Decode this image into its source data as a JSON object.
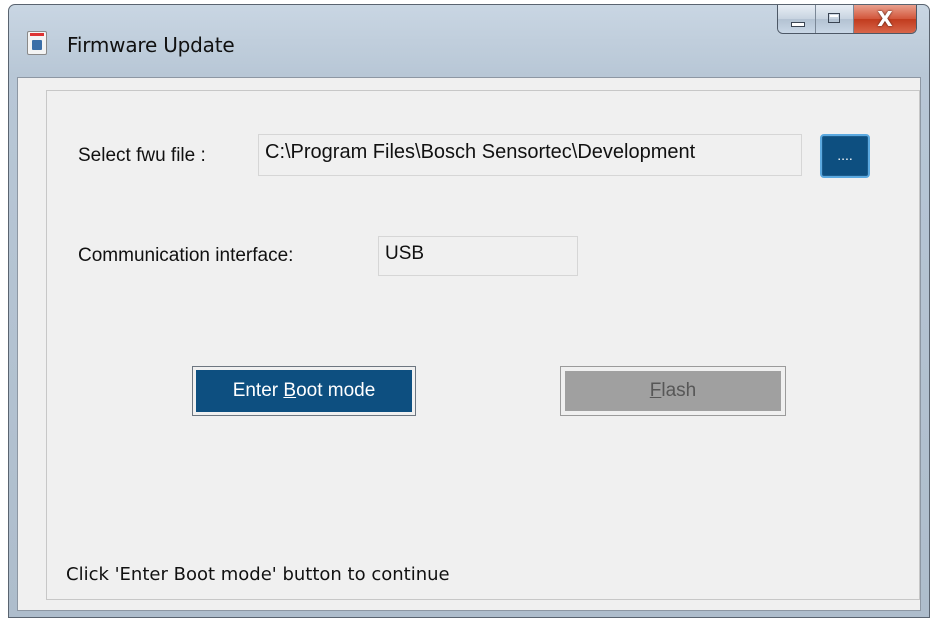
{
  "window": {
    "title": "Firmware Update",
    "icon": "bosch-app-icon"
  },
  "caption_buttons": {
    "minimize_icon": "minimize-icon",
    "maximize_icon": "maximize-icon",
    "close_glyph": "X"
  },
  "form": {
    "file_label": "Select fwu file :",
    "file_value": "C:\\Program Files\\Bosch Sensortec\\Development",
    "browse_label": "....",
    "interface_label": "Communication interface:",
    "interface_value": "USB"
  },
  "buttons": {
    "boot_prefix": "Enter ",
    "boot_mnemonic": "B",
    "boot_suffix": "oot mode",
    "flash_mnemonic": "F",
    "flash_suffix": "lash"
  },
  "status": {
    "text": "Click 'Enter Boot mode' button to continue"
  },
  "colors": {
    "accent_button": "#0d4f80",
    "disabled_button": "#a0a0a0",
    "close_button": "#c13b1e"
  }
}
